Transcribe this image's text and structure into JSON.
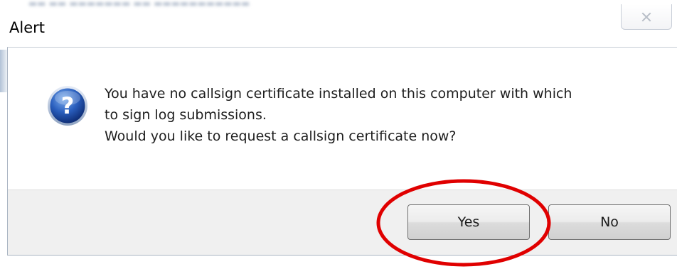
{
  "window": {
    "title": "Alert",
    "close_glyph": "✕"
  },
  "message": {
    "lines": [
      "You have no callsign certificate installed on this computer with which",
      "to sign log submissions.",
      "Would you like to request a callsign certificate now?"
    ]
  },
  "buttons": {
    "yes_label": "Yes",
    "no_label": "No"
  },
  "icons": {
    "message_icon": "question-icon",
    "close_icon": "close-icon"
  },
  "colors": {
    "annotation": "#e00000",
    "question_icon_blue": "#1d4fa3",
    "footer_bg": "#f0f0f0"
  }
}
